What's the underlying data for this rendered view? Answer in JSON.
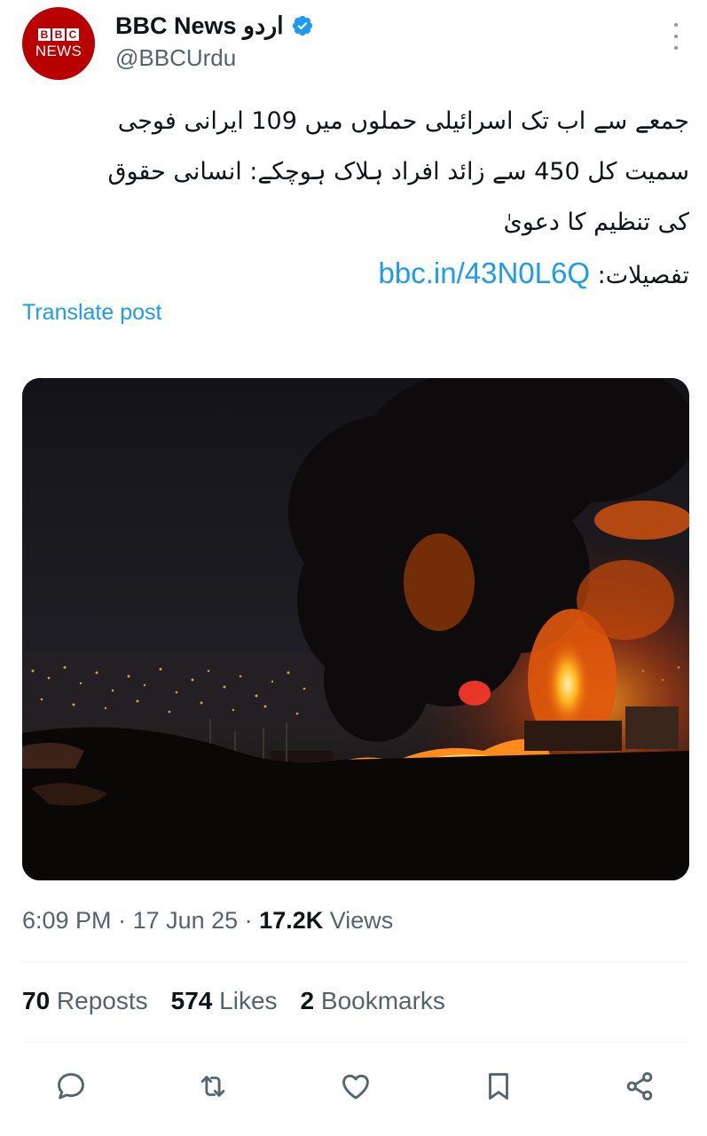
{
  "account": {
    "avatar_blocks": [
      "B",
      "B",
      "C"
    ],
    "avatar_word": "NEWS",
    "display_name": "BBC News اردو",
    "handle": "@BBCUrdu",
    "verified_icon": "verified-badge-icon",
    "more_icon": "more-options-icon"
  },
  "tweet": {
    "line1": "جمعے سے اب تک اسرائیلی حملوں میں 109 ایرانی فوجی",
    "line2": "سمیت کل 450 سے زائد افراد ہلاک ہوچکے: انسانی حقوق",
    "line3": "کی تنظیم کا دعویٰ",
    "details_label": "تفصیلات: ",
    "link": "bbc.in/43N0L6Q",
    "translate": "Translate post"
  },
  "meta": {
    "time": "6:09 PM",
    "sep1": " · ",
    "date": "17 Jun 25",
    "sep2": " · ",
    "views_count": "17.2K",
    "views_label": " Views"
  },
  "stats": {
    "reposts_count": "70",
    "reposts_label": " Reposts",
    "likes_count": "574",
    "likes_label": " Likes",
    "bookmarks_count": "2",
    "bookmarks_label": " Bookmarks"
  },
  "actions": [
    "reply-icon",
    "repost-icon",
    "like-icon",
    "bookmark-icon",
    "share-icon"
  ],
  "colors": {
    "link": "#1d9bf0",
    "secondary_text": "#536471",
    "primary_text": "#0f1419",
    "avatar": "#b80000"
  }
}
